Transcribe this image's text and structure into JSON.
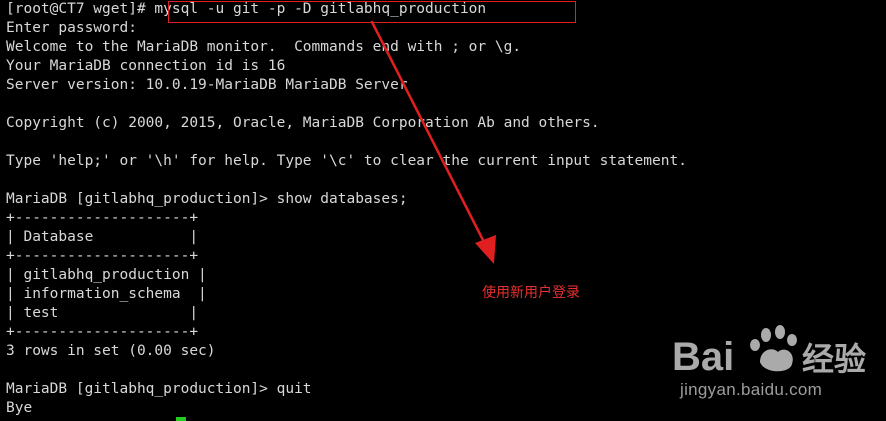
{
  "terminal": {
    "lines": [
      "[root@CT7 wget]# mysql -u git -p -D gitlabhq_production",
      "Enter password:",
      "Welcome to the MariaDB monitor.  Commands end with ; or \\g.",
      "Your MariaDB connection id is 16",
      "Server version: 10.0.19-MariaDB MariaDB Server",
      "",
      "Copyright (c) 2000, 2015, Oracle, MariaDB Corporation Ab and others.",
      "",
      "Type 'help;' or '\\h' for help. Type '\\c' to clear the current input statement.",
      "",
      "MariaDB [gitlabhq_production]> show databases;",
      "+--------------------+",
      "| Database           |",
      "+--------------------+",
      "| gitlabhq_production |",
      "| information_schema  |",
      "| test               |",
      "+--------------------+",
      "3 rows in set (0.00 sec)",
      "",
      "MariaDB [gitlabhq_production]> quit",
      "Bye"
    ]
  },
  "annotation": {
    "text": "使用新用户登录",
    "color": "#e83030"
  },
  "watermark": {
    "brand": "Bai度经验",
    "url": "jingyan.baidu.com"
  },
  "colors": {
    "background": "#000000",
    "text": "#d8d8d8",
    "highlight": "#e02020",
    "cursor": "#22cc22"
  }
}
